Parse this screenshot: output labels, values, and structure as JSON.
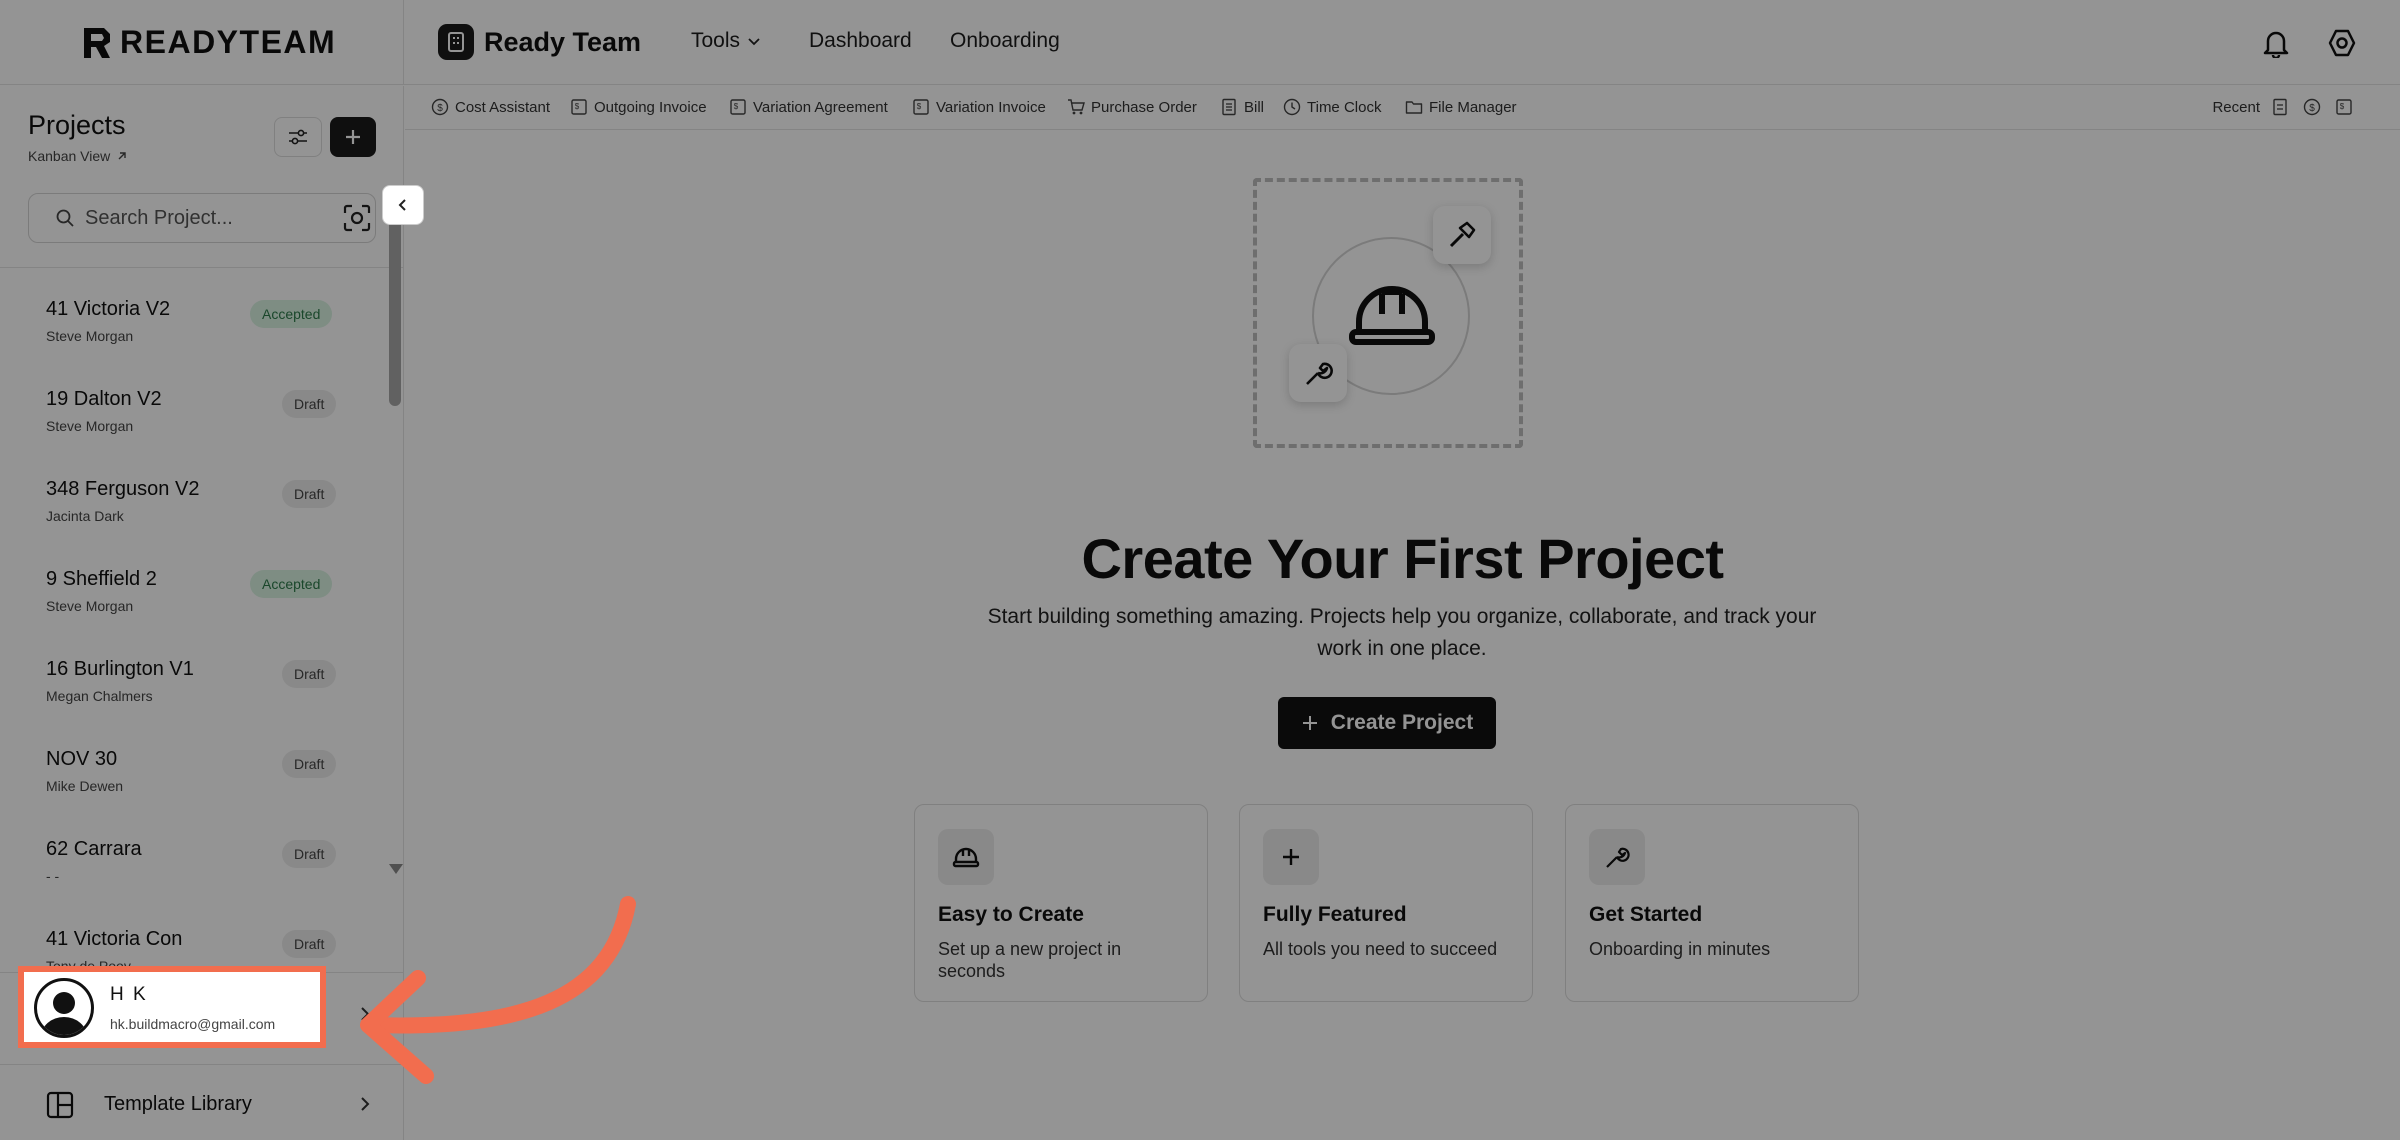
{
  "brand": {
    "logo_text": "READYTEAM",
    "team_name": "Ready Team"
  },
  "nav": {
    "tools": "Tools",
    "dashboard": "Dashboard",
    "onboarding": "Onboarding"
  },
  "toolbar": {
    "items": [
      {
        "label": "Cost Assistant",
        "icon": "dollar-circle-icon"
      },
      {
        "label": "Outgoing Invoice",
        "icon": "invoice-icon"
      },
      {
        "label": "Variation Agreement",
        "icon": "invoice-icon"
      },
      {
        "label": "Variation Invoice",
        "icon": "invoice-icon"
      },
      {
        "label": "Purchase Order",
        "icon": "cart-icon"
      },
      {
        "label": "Bill",
        "icon": "bill-icon"
      },
      {
        "label": "Time Clock",
        "icon": "clock-icon"
      },
      {
        "label": "File Manager",
        "icon": "folder-icon"
      }
    ],
    "recent_label": "Recent"
  },
  "sidebar": {
    "title": "Projects",
    "kanban_link": "Kanban View",
    "search_placeholder": "Search Project...",
    "projects": [
      {
        "name": "41 Victoria V2",
        "owner": "Steve Morgan",
        "status": "Accepted"
      },
      {
        "name": "19 Dalton V2",
        "owner": "Steve Morgan",
        "status": "Draft"
      },
      {
        "name": "348 Ferguson V2",
        "owner": "Jacinta Dark",
        "status": "Draft"
      },
      {
        "name": "9 Sheffield 2",
        "owner": "Steve Morgan",
        "status": "Accepted"
      },
      {
        "name": "16 Burlington V1",
        "owner": "Megan Chalmers",
        "status": "Draft"
      },
      {
        "name": "NOV 30",
        "owner": "Mike Dewen",
        "status": "Draft"
      },
      {
        "name": "62 Carrara",
        "owner": "- -",
        "status": "Draft"
      },
      {
        "name": "41 Victoria Con",
        "owner": "Tony de Pooy",
        "status": "Draft"
      }
    ],
    "user": {
      "name": "H K",
      "email": "hk.buildmacro@gmail.com"
    },
    "template_library": "Template Library"
  },
  "main": {
    "headline": "Create Your First Project",
    "subtext": "Start building something amazing. Projects help you organize, collaborate, and track your work in one place.",
    "create_button": "Create Project",
    "features": [
      {
        "title": "Easy to Create",
        "desc": "Set up a new project in seconds",
        "icon": "helmet-icon"
      },
      {
        "title": "Fully Featured",
        "desc": "All tools you need to succeed",
        "icon": "plus-icon"
      },
      {
        "title": "Get Started",
        "desc": "Onboarding in minutes",
        "icon": "wrench-icon"
      }
    ]
  },
  "colors": {
    "accent": "#f26d4e",
    "accepted_bg": "#d9f3e2",
    "accepted_text": "#2d7a4a",
    "draft_bg": "#ececec",
    "primary": "#121212"
  }
}
